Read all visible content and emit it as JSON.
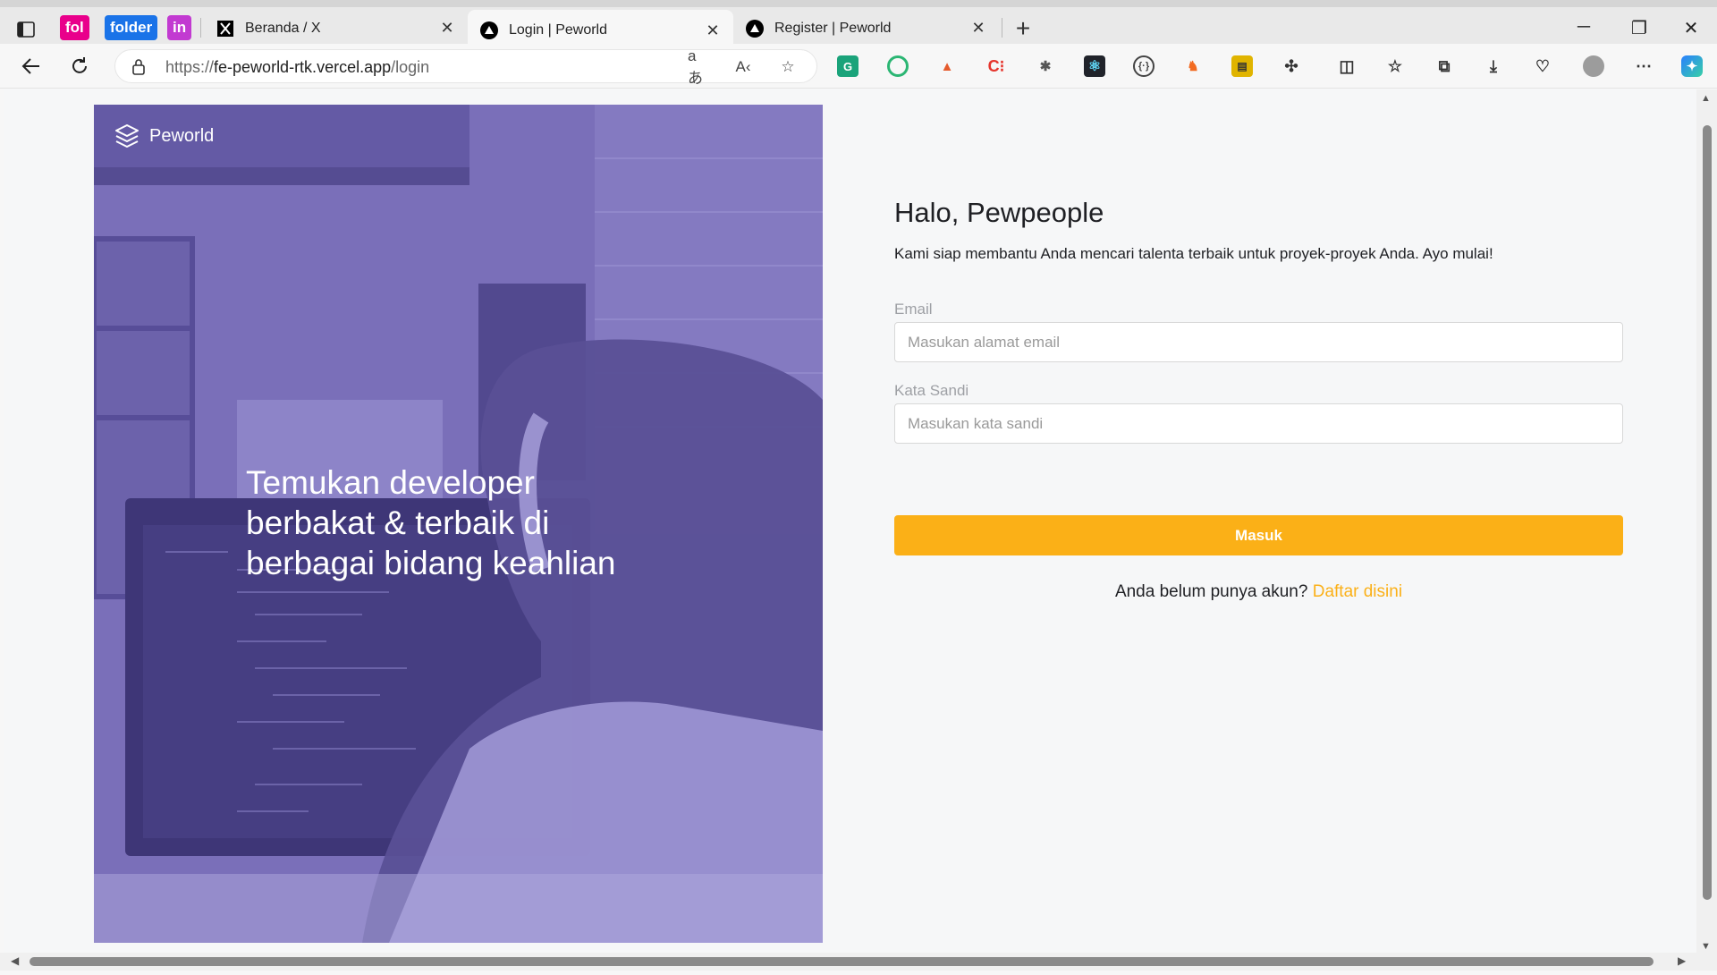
{
  "browser": {
    "pinned_tabs": [
      "fol",
      "folder",
      "in"
    ],
    "tabs": [
      {
        "title": "Beranda / X"
      },
      {
        "title": "Login | Peworld"
      },
      {
        "title": "Register | Peworld"
      }
    ],
    "url_prefix": "https://",
    "url_host": "fe-peworld-rtk.vercel.app",
    "url_path": "/login"
  },
  "hero": {
    "brand": "Peworld",
    "tagline": "Temukan developer berbakat & terbaik di berbagai bidang keahlian"
  },
  "form": {
    "title": "Halo, Pewpeople",
    "subtitle": "Kami siap membantu Anda mencari talenta terbaik untuk proyek-proyek Anda. Ayo mulai!",
    "email_label": "Email",
    "email_placeholder": "Masukan alamat email",
    "password_label": "Kata Sandi",
    "password_placeholder": "Masukan kata sandi",
    "submit_label": "Masuk",
    "register_prompt": "Anda belum punya akun?",
    "register_link": "Daftar disini"
  },
  "colors": {
    "accent": "#fbb017",
    "hero_overlay": "#7b70ba"
  }
}
